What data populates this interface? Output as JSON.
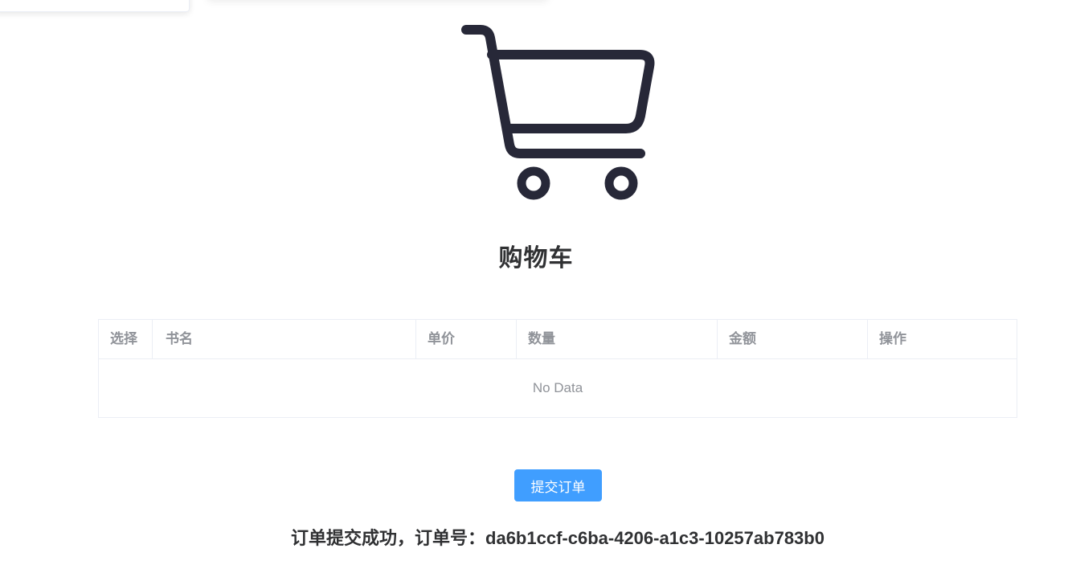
{
  "header": {
    "title": "购物车"
  },
  "icons": {
    "cart": "shopping-cart-icon"
  },
  "table": {
    "columns": [
      "选择",
      "书名",
      "单价",
      "数量",
      "金额",
      "操作"
    ],
    "empty_text": "No Data"
  },
  "actions": {
    "submit_label": "提交订单"
  },
  "result": {
    "message": "订单提交成功，订单号：da6b1ccf-c6ba-4206-a1c3-10257ab783b0"
  },
  "colors": {
    "primary": "#409eff",
    "title_text": "#303133",
    "muted_text": "#909399",
    "border": "#ebeef5",
    "icon": "#272838"
  }
}
